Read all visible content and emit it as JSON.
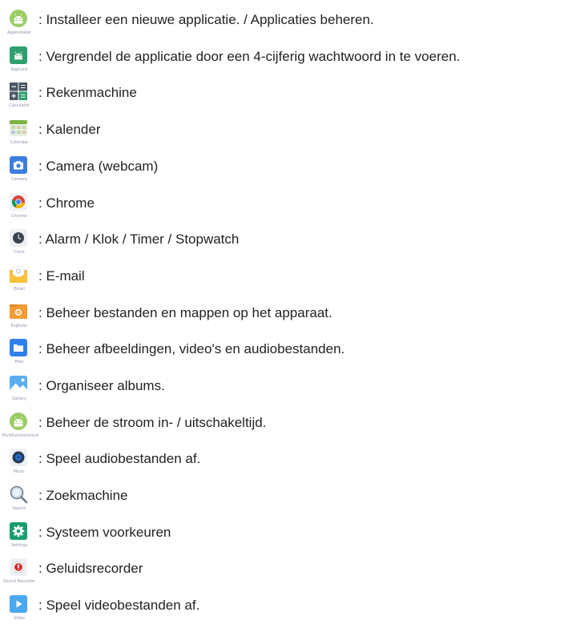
{
  "items": [
    {
      "icon": "android-icon",
      "caption": "Appinstaller",
      "text": ": Installeer een nieuwe applicatie. / Applicaties beheren."
    },
    {
      "icon": "android-lock-icon",
      "caption": "AppLock",
      "text": ": Vergrendel de applicatie door een 4-cijferig wachtwoord in te voeren."
    },
    {
      "icon": "calculator-icon",
      "caption": "Calculator",
      "text": ": Rekenmachine"
    },
    {
      "icon": "calendar-icon",
      "caption": "Calendar",
      "text": ": Kalender"
    },
    {
      "icon": "camera-icon",
      "caption": "Camera",
      "text": ": Camera (webcam)"
    },
    {
      "icon": "chrome-icon",
      "caption": "Chrome",
      "text": ": Chrome"
    },
    {
      "icon": "clock-icon",
      "caption": "Clock",
      "text": ": Alarm / Klok / Timer / Stopwatch"
    },
    {
      "icon": "email-icon",
      "caption": "Email",
      "text": ": E-mail"
    },
    {
      "icon": "explorer-icon",
      "caption": "Explorer",
      "text": ": Beheer bestanden en mappen op het apparaat."
    },
    {
      "icon": "files-icon",
      "caption": "Files",
      "text": ": Beheer afbeeldingen, video's en audiobestanden."
    },
    {
      "icon": "gallery-icon",
      "caption": "Gallery",
      "text": ": Organiseer albums."
    },
    {
      "icon": "android-icon",
      "caption": "Multifunctionclock",
      "text": ": Beheer de stroom in- / uitschakeltijd."
    },
    {
      "icon": "music-icon",
      "caption": "Music",
      "text": ": Speel audiobestanden af."
    },
    {
      "icon": "search-icon",
      "caption": "Search",
      "text": ": Zoekmachine"
    },
    {
      "icon": "settings-icon",
      "caption": "Settings",
      "text": ": Systeem voorkeuren"
    },
    {
      "icon": "sound-recorder-icon",
      "caption": "Sound Recorder",
      "text": ": Geluidsrecorder"
    },
    {
      "icon": "video-icon",
      "caption": "Video",
      "text": ": Speel videobestanden af."
    }
  ],
  "colors": {
    "android_green": "#9ccc65",
    "applock_green": "#2e9f6e",
    "camera_blue": "#3d7de0",
    "files_blue": "#2f80ed",
    "settings_green": "#1a9e6e",
    "video_blue": "#4aa8f0",
    "text": "#222222",
    "caption": "#8a96a8"
  }
}
